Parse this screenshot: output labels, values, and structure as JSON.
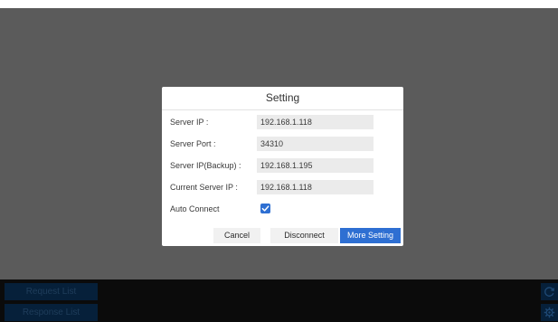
{
  "dialog": {
    "title": "Setting",
    "fields": [
      {
        "label": "Server IP :",
        "value": "192.168.1.118"
      },
      {
        "label": "Server Port :",
        "value": "34310"
      },
      {
        "label": "Server IP(Backup) :",
        "value": "192.168.1.195"
      },
      {
        "label": "Current Server IP :",
        "value": "192.168.1.118"
      }
    ],
    "auto_connect": {
      "label": "Auto Connect",
      "checked": true
    },
    "buttons": {
      "cancel": "Cancel",
      "disconnect": "Disconnect",
      "more_setting": "More Setting"
    }
  },
  "bottom": {
    "request_list": "Request List",
    "response_list": "Response List",
    "icons": [
      "refresh-icon",
      "gear-icon"
    ]
  },
  "colors": {
    "accent": "#2e6fd2",
    "overlay": "#5b5b5b",
    "bottom_bar": "#0b0b0b",
    "bottom_button": "#06203a"
  }
}
